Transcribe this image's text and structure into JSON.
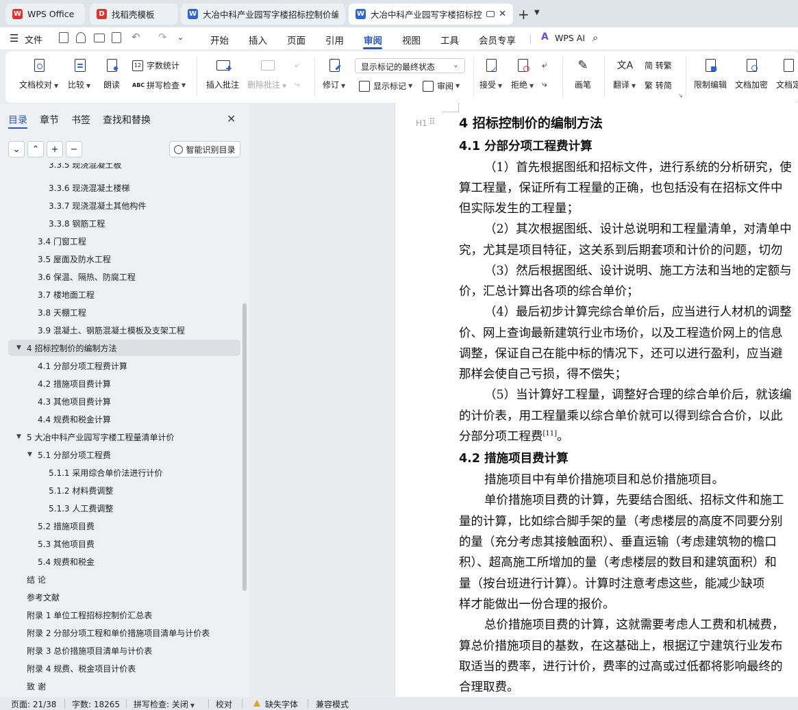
{
  "tabs": [
    {
      "label": "WPS Office",
      "icon": "wps-logo-icon",
      "color": "#e8302f"
    },
    {
      "label": "找稻壳模板",
      "icon": "docer-icon",
      "color": "#e8302f"
    },
    {
      "label": "大冶中科产业园写字楼招标控制价编制",
      "icon": "word-doc-icon",
      "color": "#2b65d9"
    },
    {
      "label": "大冶中科产业园写字楼招标控制",
      "icon": "word-doc-icon",
      "color": "#2b65d9"
    }
  ],
  "menu": {
    "file": "文件",
    "items": [
      "开始",
      "插入",
      "页面",
      "引用",
      "审阅",
      "视图",
      "工具",
      "会员专享"
    ],
    "active": "审阅",
    "ai": "WPS AI"
  },
  "ribbon": {
    "proofread": "文档校对",
    "compare": "比较",
    "read_aloud": "朗读",
    "word_count": "字数统计",
    "spell_check": "拼写检查",
    "insert_comment": "插入批注",
    "delete_comment": "删除批注",
    "track_changes": "修订",
    "track_state": "显示标记的最终状态",
    "show_markup": "显示标记",
    "review": "审阅",
    "accept": "接受",
    "reject": "拒绝",
    "pen": "画笔",
    "translate": "翻译",
    "to_traditional": "简 转繁",
    "to_simplified": "繁 转简",
    "restrict_edit": "限制编辑",
    "encrypt": "文档加密",
    "finalize": "文档定"
  },
  "nav": {
    "tabs": [
      "目录",
      "章节",
      "书签",
      "查找和替换"
    ],
    "active_tab": "目录",
    "smart_toc": "智能识别目录",
    "toc": [
      {
        "text": "3.3.5  现浇混凝土板",
        "level": 3
      },
      {
        "text": "3.3.6  现浇混凝土楼梯",
        "level": 3
      },
      {
        "text": "3.3.7  现浇混凝土其他构件",
        "level": 3
      },
      {
        "text": "3.3.8  钢筋工程",
        "level": 3
      },
      {
        "text": "3.4  门窗工程",
        "level": 2
      },
      {
        "text": "3.5  屋面及防水工程",
        "level": 2
      },
      {
        "text": "3.6  保温、隔热、防腐工程",
        "level": 2
      },
      {
        "text": "3.7  楼地面工程",
        "level": 2
      },
      {
        "text": "3.8  天棚工程",
        "level": 2
      },
      {
        "text": "3.9  混凝土、钢筋混凝土模板及支架工程",
        "level": 2
      },
      {
        "text": "4  招标控制价的编制方法",
        "level": 1,
        "expanded": true,
        "selected": true
      },
      {
        "text": "4.1  分部分项工程费计算",
        "level": 2
      },
      {
        "text": "4.2  措施项目费计算",
        "level": 2
      },
      {
        "text": "4.3  其他项目费计算",
        "level": 2
      },
      {
        "text": "4.4  规费和税金计算",
        "level": 2
      },
      {
        "text": "5 大冶中科产业园写字楼工程量清单计价",
        "level": 1,
        "expanded": true
      },
      {
        "text": "5.1  分部分项工程费",
        "level": 2,
        "expanded": true
      },
      {
        "text": "5.1.1 采用综合单价法进行计价",
        "level": 3
      },
      {
        "text": "5.1.2 材料费调整",
        "level": 3
      },
      {
        "text": "5.1.3 人工费调整",
        "level": 3
      },
      {
        "text": "5.2  措施项目费",
        "level": 2
      },
      {
        "text": "5.3  其他项目费",
        "level": 2
      },
      {
        "text": "5.4  规费和税金",
        "level": 2
      },
      {
        "text": "结    论",
        "level": 1
      },
      {
        "text": "参考文献",
        "level": 1
      },
      {
        "text": "附录 1 单位工程招标控制价汇总表",
        "level": 1
      },
      {
        "text": "附录 2 分部分项工程和单价措施项目清单与计价表",
        "level": 1
      },
      {
        "text": "附录 3 总价措施项目清单与计价表",
        "level": 1
      },
      {
        "text": "附录 4 规费、税金项目计价表",
        "level": 1
      },
      {
        "text": "致    谢",
        "level": 1
      }
    ]
  },
  "document": {
    "heading_marker": "H1",
    "lines": [
      {
        "t": "4  招标控制价的编制方法",
        "k": "h1"
      },
      {
        "t": "4.1  分部分项工程费计算",
        "k": "h2"
      },
      {
        "t": "（1）首先根据图纸和招标文件，进行系统的分析研究，使",
        "k": "ind"
      },
      {
        "t": "算工程量，保证所有工程量的正确，也包括没有在招标文件中",
        "k": "p"
      },
      {
        "t": "但实际发生的工程量；",
        "k": "p"
      },
      {
        "t": "（2）其次根据图纸、设计总说明和工程量清单，对清单中",
        "k": "ind"
      },
      {
        "t": "究，尤其是项目特征，这关系到后期套项和计价的问题，切勿",
        "k": "p"
      },
      {
        "t": "（3）然后根据图纸、设计说明、施工方法和当地的定额与",
        "k": "ind"
      },
      {
        "t": "价，汇总计算出各项的综合单价；",
        "k": "p"
      },
      {
        "t": "（4）最后初步计算完综合单价后，应当进行人材机的调整",
        "k": "ind"
      },
      {
        "t": "价、网上查询最新建筑行业市场价，以及工程造价网上的信息",
        "k": "p"
      },
      {
        "t": "调整，保证自己在能中标的情况下，还可以进行盈利，应当避",
        "k": "p"
      },
      {
        "t": "那样会使自己亏损，得不偿失；",
        "k": "p"
      },
      {
        "t": "（5）当计算好工程量，调整好合理的综合单价后，就该编",
        "k": "ind"
      },
      {
        "t": "的计价表，用工程量乘以综合单价就可以得到综合合价，以此",
        "k": "p"
      },
      {
        "t": "分部分项工程费",
        "k": "p",
        "sup": "[11]",
        "after": "。"
      },
      {
        "t": "4.2  措施项目费计算",
        "k": "h2"
      },
      {
        "t": "措施项目中有单价措施项目和总价措施项目。",
        "k": "ind"
      },
      {
        "t": "单价措施项目费的计算，先要结合图纸、招标文件和施工",
        "k": "ind"
      },
      {
        "t": "量的计算，比如综合脚手架的量（考虑楼层的高度不同要分别",
        "k": "p"
      },
      {
        "t": "的量（充分考虑其接触面积）、垂直运输（考虑建筑物的檐口",
        "k": "p"
      },
      {
        "t": "积）、超高施工所增加的量（考虑楼层的数目和建筑面积）和",
        "k": "p"
      },
      {
        "t": "量（按台班进行计算）。计算时注意考虑这些，能减少缺项",
        "k": "p"
      },
      {
        "t": "样才能做出一份合理的报价。",
        "k": "p"
      },
      {
        "t": "总价措施项目费的计算，这就需要考虑人工费和机械费，",
        "k": "ind"
      },
      {
        "t": "算总价措施项目的基数，在这基础上，根据辽宁建筑行业发布",
        "k": "p"
      },
      {
        "t": "取适当的费率，进行计价，费率的过高或过低都将影响最终的",
        "k": "p"
      },
      {
        "t": "合理取费。",
        "k": "p"
      }
    ]
  },
  "status": {
    "page": "页面: 21/38",
    "words": "字数: 18265",
    "spell": "拼写检查: 关闭",
    "proof": "校对",
    "missing_font": "缺失字体",
    "compat": "兼容模式"
  }
}
